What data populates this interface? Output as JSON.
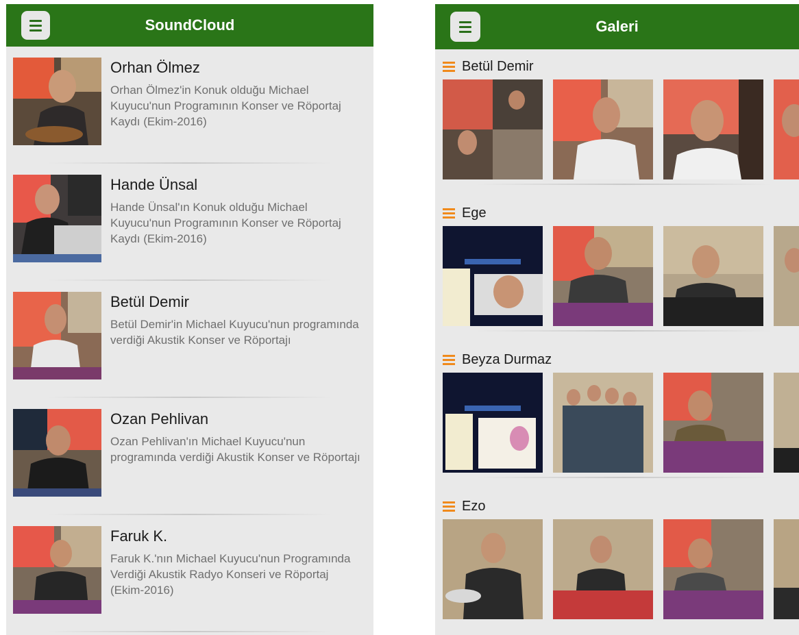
{
  "soundcloud": {
    "title": "SoundCloud",
    "items": [
      {
        "title": "Orhan Ölmez",
        "description": "Orhan Ölmez'in Konuk olduğu  Michael Kuyucu'nun Programının Konser ve Röportaj Kaydı (Ekim-2016)"
      },
      {
        "title": "Hande Ünsal",
        "description": "Hande Ünsal'ın Konuk olduğu  Michael Kuyucu'nun Programının Konser ve Röportaj Kaydı (Ekim-2016)"
      },
      {
        "title": "Betül Demir",
        "description": "Betül Demir'in Michael Kuyucu'nun programında verdiği Akustik Konser ve Röportajı"
      },
      {
        "title": "Ozan Pehlivan",
        "description": "Ozan Pehlivan'ın Michael Kuyucu'nun programında verdiği Akustik Konser ve Röportajı"
      },
      {
        "title": "Faruk K.",
        "description": "Faruk K.'nın Michael Kuyucu'nun Programında Verdiği Akustik Radyo Konseri ve Röportaj (Ekim-2016)"
      }
    ]
  },
  "gallery": {
    "title": "Galeri",
    "sections": [
      {
        "title": "Betül Demir"
      },
      {
        "title": "Ege"
      },
      {
        "title": "Beyza Durmaz"
      },
      {
        "title": "Ezo"
      }
    ]
  },
  "icons": {
    "menu": "hamburger-menu-icon",
    "section": "orange-list-icon"
  },
  "colors": {
    "appbar": "#2a7518",
    "background": "#e9e9e9",
    "section_icon": "#f08a1c"
  }
}
